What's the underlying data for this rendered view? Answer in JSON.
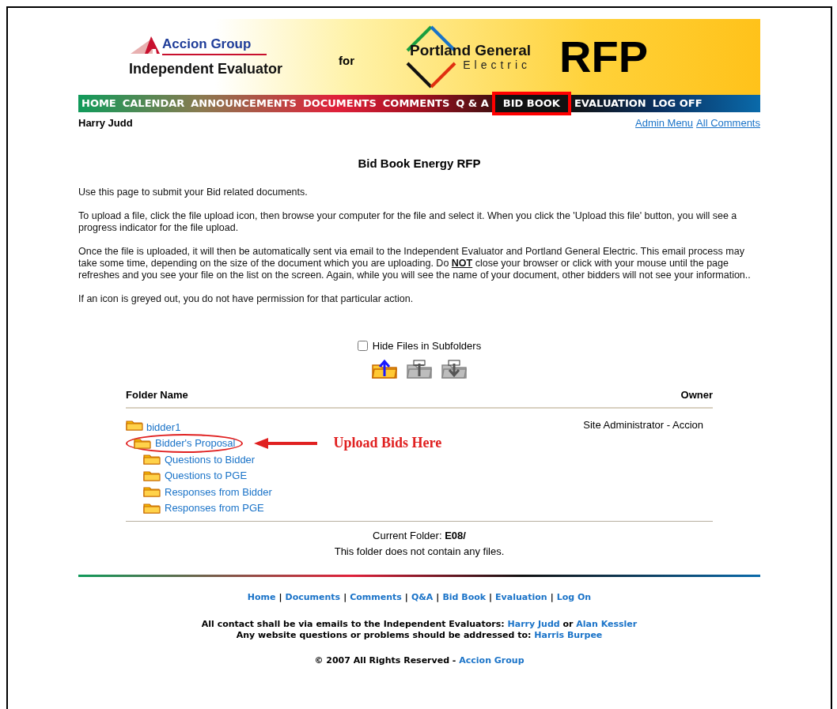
{
  "header": {
    "brand": "Accion Group",
    "brand_subtitle": "Independent Evaluator",
    "connector": "for",
    "client_line1": "Portland General",
    "client_line2": "Electric",
    "badge": "RFP"
  },
  "nav": [
    {
      "label": "HOME",
      "selected": false
    },
    {
      "label": "CALENDAR",
      "selected": false
    },
    {
      "label": "ANNOUNCEMENTS",
      "selected": false
    },
    {
      "label": "DOCUMENTS",
      "selected": false
    },
    {
      "label": "COMMENTS",
      "selected": false
    },
    {
      "label": "Q & A",
      "selected": false
    },
    {
      "label": "BID BOOK",
      "selected": true
    },
    {
      "label": "EVALUATION",
      "selected": false
    },
    {
      "label": "LOG OFF",
      "selected": false
    }
  ],
  "user": "Harry Judd",
  "admin_links": [
    "Admin Menu",
    "All Comments"
  ],
  "title": "Bid Book Energy RFP",
  "paragraphs": [
    "Use this page to submit your Bid related documents.",
    "To upload a file, click the file upload icon, then browse your computer for the file and select it. When you click the 'Upload this file' button, you will see a progress indicator for the file upload.",
    "Once the file is uploaded, it will then be automatically sent via email to the Independent Evaluator and Portland General Electric.  This email process may take some time, depending on the size of the document which you are uploading. Do **NOT** close your browser or click with your mouse until the page refreshes and you see your file on the list on the screen.  Again, while you will see the name of your document, other bidders will not see your information..",
    "If an icon is greyed out, you do not have permission for that particular action."
  ],
  "hide_subfolders": {
    "label": "Hide Files in Subfolders",
    "checked": false
  },
  "toolbar": [
    {
      "kind": "upload",
      "disabled": false
    },
    {
      "kind": "move",
      "disabled": true
    },
    {
      "kind": "download",
      "disabled": true
    }
  ],
  "table": {
    "columns": [
      "Folder Name",
      "Owner"
    ],
    "folders": [
      {
        "name": "bidder1",
        "owner": "Site Administrator - Accion",
        "children": [
          {
            "name": "Bidder's Proposal",
            "highlighted": true
          },
          {
            "name": "Questions to Bidder",
            "highlighted": false
          },
          {
            "name": "Questions to PGE",
            "highlighted": false
          },
          {
            "name": "Responses from Bidder",
            "highlighted": false
          },
          {
            "name": "Responses from PGE",
            "highlighted": false
          }
        ]
      }
    ]
  },
  "annotation": {
    "label": "Upload Bids Here"
  },
  "current_folder": {
    "label": "Current Folder:",
    "value": "E08/"
  },
  "empty_message": "This folder does not contain any files.",
  "footer": {
    "links": [
      "Home",
      "Documents",
      "Comments",
      "Q&A",
      "Bid Book",
      "Evaluation",
      "Log On"
    ],
    "separator": "|",
    "lines": [
      [
        {
          "text": "All contact shall be via emails to the Independent Evaluators: "
        },
        {
          "link": "Harry Judd"
        },
        {
          "text": " or "
        },
        {
          "link": "Alan Kessler"
        }
      ],
      [
        {
          "text": "Any website questions or problems should be addressed to: "
        },
        {
          "link": "Harris Burpee"
        }
      ]
    ],
    "copyright": [
      {
        "text": "© 2007 All Rights Reserved - "
      },
      {
        "link": "Accion Group"
      }
    ]
  }
}
